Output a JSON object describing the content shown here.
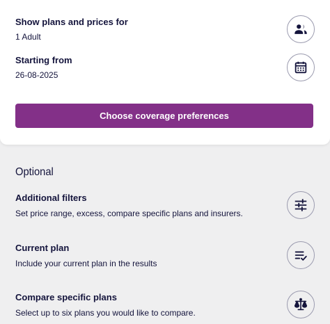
{
  "summary": {
    "plans_for": {
      "label": "Show plans and prices for",
      "value": "1 Adult",
      "icon": "people-icon"
    },
    "starting_from": {
      "label": "Starting from",
      "value": "26-08-2025",
      "icon": "calendar-icon"
    }
  },
  "cta": {
    "label": "Choose coverage preferences",
    "color": "#833088"
  },
  "optional": {
    "heading": "Optional",
    "items": [
      {
        "title": "Additional filters",
        "description": "Set price range, excess, compare specific plans and insurers.",
        "icon": "sliders-icon"
      },
      {
        "title": "Current plan",
        "description": "Include your current plan in the results",
        "icon": "list-check-icon"
      },
      {
        "title": "Compare specific plans",
        "description": "Select up to six plans you would like to compare.",
        "icon": "scale-icon"
      }
    ]
  },
  "colors": {
    "text": "#14143c",
    "background": "#efeff0",
    "card": "#ffffff",
    "accent": "#833088"
  }
}
